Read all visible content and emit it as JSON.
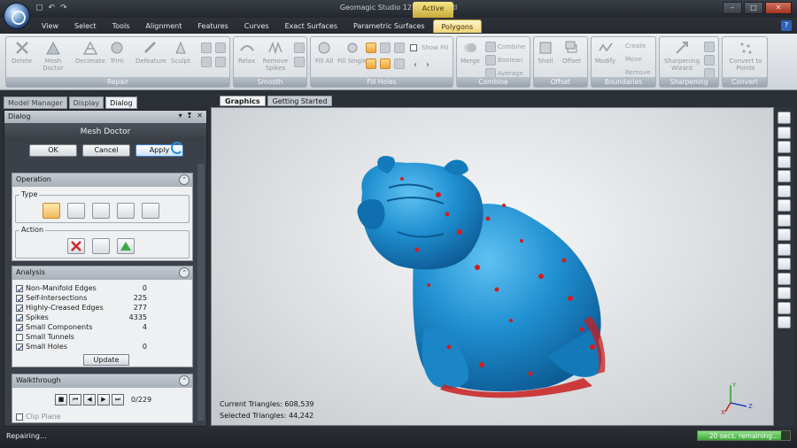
{
  "window": {
    "title": "Geomagic Studio 12 – Bulldog.stl",
    "active_label": "Active"
  },
  "ribbon_tabs": [
    "View",
    "Select",
    "Tools",
    "Alignment",
    "Features",
    "Curves",
    "Exact Surfaces",
    "Parametric Surfaces",
    "Polygons"
  ],
  "selected_tab": "Polygons",
  "ribbon": {
    "repair": {
      "label": "Repair",
      "buttons": [
        "Delete",
        "Mesh Doctor",
        "Decimate",
        "Trim",
        "Defeature",
        "Sculpt"
      ]
    },
    "smooth": {
      "label": "Smooth",
      "buttons": [
        "Relax",
        "Remove Spikes"
      ]
    },
    "fill_holes": {
      "label": "Fill Holes",
      "buttons": [
        "Fill All",
        "Fill Single"
      ],
      "show_fill": "Show Fill"
    },
    "combine": {
      "label": "Combine",
      "buttons": [
        "Merge"
      ],
      "small": [
        "Combine",
        "Boolean",
        "Average"
      ]
    },
    "offset": {
      "label": "Offset",
      "buttons": [
        "Shell",
        "Offset"
      ]
    },
    "boundaries": {
      "label": "Boundaries",
      "buttons": [
        "Modify"
      ],
      "small": [
        "Create",
        "Move",
        "Remove"
      ]
    },
    "sharpening": {
      "label": "Sharpening",
      "buttons": [
        "Sharpening Wizard"
      ]
    },
    "convert": {
      "label": "Convert",
      "buttons": [
        "Convert to Points"
      ]
    }
  },
  "left_tabs": [
    "Model Manager",
    "Display",
    "Dialog"
  ],
  "panel": {
    "header": "Dialog",
    "title": "Mesh Doctor",
    "ok": "OK",
    "cancel": "Cancel",
    "apply": "Apply",
    "operation": {
      "label": "Operation",
      "type_label": "Type",
      "action_label": "Action"
    },
    "analysis": {
      "label": "Analysis",
      "rows": [
        {
          "label": "Non-Manifold Edges",
          "value": "0",
          "checked": true
        },
        {
          "label": "Self-Intersections",
          "value": "225",
          "checked": true
        },
        {
          "label": "Highly-Creased Edges",
          "value": "277",
          "checked": true
        },
        {
          "label": "Spikes",
          "value": "4335",
          "checked": true
        },
        {
          "label": "Small Components",
          "value": "4",
          "checked": true
        },
        {
          "label": "Small Tunnels",
          "value": "",
          "checked": false
        },
        {
          "label": "Small Holes",
          "value": "0",
          "checked": true
        }
      ],
      "update": "Update"
    },
    "walkthrough": {
      "label": "Walkthrough",
      "counter": "0/229",
      "clip_plane": "Clip Plane"
    }
  },
  "viewport_tabs": [
    "Graphics",
    "Getting Started"
  ],
  "viewport": {
    "current_triangles": "Current Triangles: 608,539",
    "selected_triangles": "Selected Triangles: 44,242",
    "axis_x": "X",
    "axis_y": "Y",
    "axis_z": "Z"
  },
  "status": {
    "text": "Repairing...",
    "progress_text": "20 secs. remaining...",
    "progress": 0.9
  },
  "colors": {
    "mesh": "#1f8fd0",
    "defects": "#d21e1e",
    "accent": "#f2d477"
  }
}
